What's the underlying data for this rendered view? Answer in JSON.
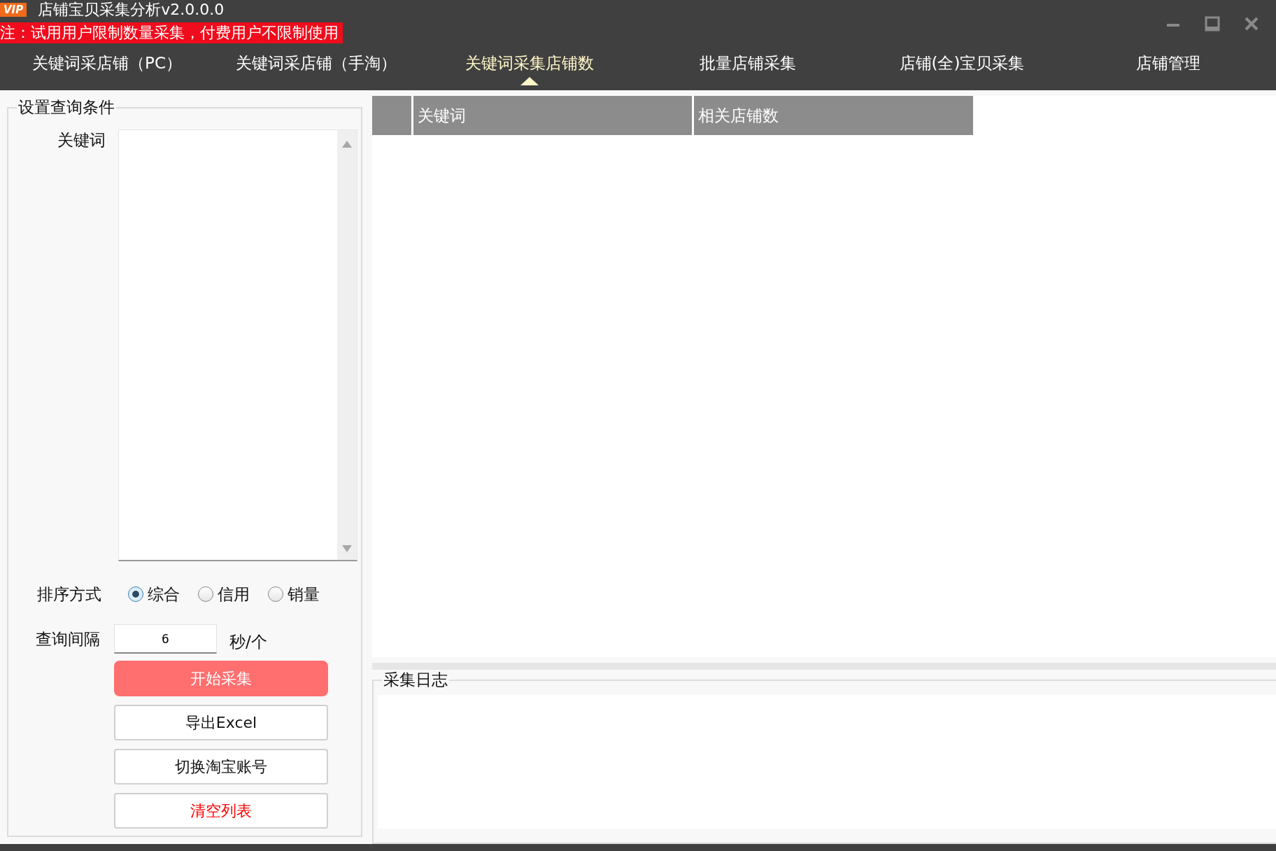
{
  "window": {
    "badge": "VIP",
    "title": "店铺宝贝采集分析v2.0.0.0",
    "notice": "注：试用用户限制数量采集，付费用户不限制使用"
  },
  "tabs": [
    {
      "label": "关键词采店铺（PC）",
      "selected": false
    },
    {
      "label": "关键词采店铺（手淘）",
      "selected": false
    },
    {
      "label": "关键词采集店铺数",
      "selected": true
    },
    {
      "label": "批量店铺采集",
      "selected": false
    },
    {
      "label": "店铺(全)宝贝采集",
      "selected": false
    },
    {
      "label": "店铺管理",
      "selected": false
    }
  ],
  "query": {
    "title": "设置查询条件",
    "keyword_label": "关键词",
    "sort_label": "排序方式",
    "sort_options": [
      {
        "label": "综合",
        "selected": true
      },
      {
        "label": "信用",
        "selected": false
      },
      {
        "label": "销量",
        "selected": false
      }
    ],
    "interval_label": "查询间隔",
    "interval_value": "6",
    "interval_unit": "秒/个",
    "buttons": [
      {
        "label": "开始采集",
        "kind": "primary"
      },
      {
        "label": "导出Excel",
        "kind": "normal"
      },
      {
        "label": "切换淘宝账号",
        "kind": "normal"
      },
      {
        "label": "清空列表",
        "kind": "danger"
      }
    ]
  },
  "table": {
    "columns": [
      "关键词",
      "相关店铺数"
    ]
  },
  "log": {
    "title": "采集日志"
  }
}
